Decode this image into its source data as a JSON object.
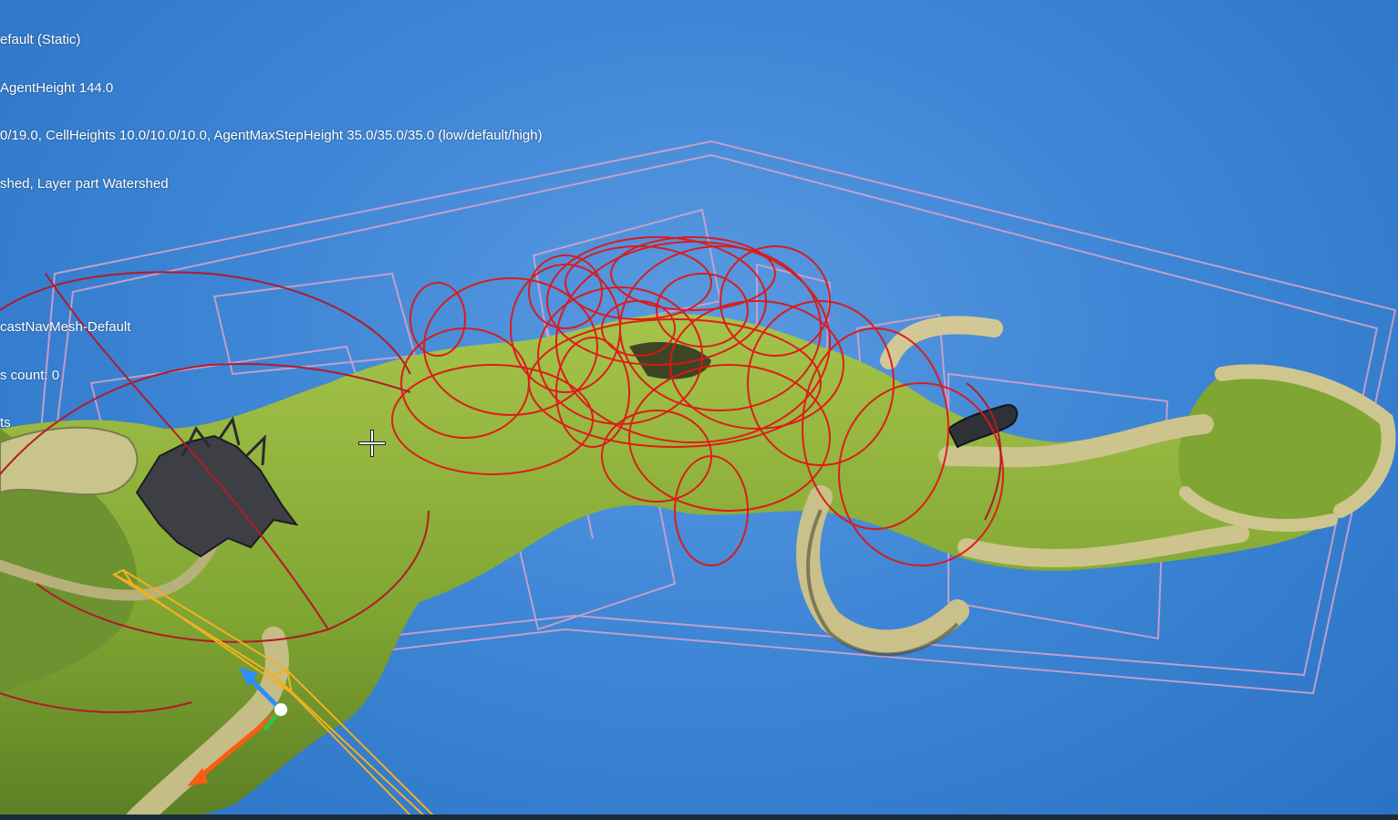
{
  "viewport": {
    "background_color": "#3e86d6",
    "terrain_color": "#8fb53a",
    "cliff_color": "#c9c48a",
    "navmesh_circle_color": "#e01818",
    "bounds_color": "#d9a0c8",
    "selection_color": "#f2b021"
  },
  "debug_text": {
    "line1": "efault (Static)",
    "line2": "AgentHeight 144.0",
    "line3": "0/19.0, CellHeights 10.0/10.0/10.0, AgentMaxStepHeight 35.0/35.0/35.0 (low/default/high)",
    "line4": "shed, Layer part Watershed",
    "line5": "castNavMesh-Default",
    "line6": "s count: 0",
    "line7": "ts"
  },
  "icons": {
    "crosshair": "crosshair-icon",
    "gizmo": "transform-gizmo-icon"
  }
}
